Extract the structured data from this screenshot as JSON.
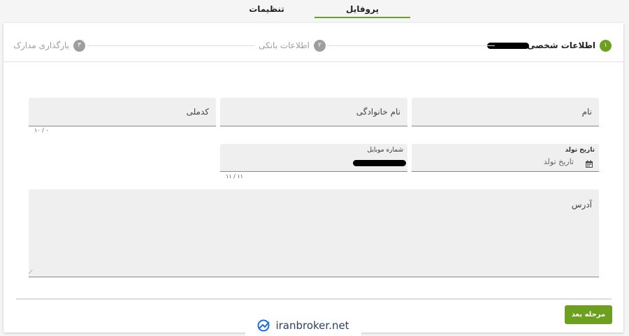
{
  "tabs": [
    {
      "label": "پروفایل",
      "active": true
    },
    {
      "label": "تنظیمات",
      "active": false
    }
  ],
  "stepper": {
    "steps": [
      {
        "num": "۱",
        "label": "اطلاعات شخصی"
      },
      {
        "num": "۲",
        "label": "اطلاعات بانکی"
      },
      {
        "num": "۳",
        "label": "بارگذاری مدارک"
      }
    ]
  },
  "form": {
    "first_name_label": "نام",
    "last_name_label": "نام خانوادگی",
    "national_code_label": "کدملی",
    "national_code_counter": "۱۰ / ۰",
    "birth_date_label": "تاریخ تولد",
    "birth_date_placeholder": "تاریخ تولد",
    "mobile_label": "شماره موبایل",
    "mobile_counter": "۱۱ / ۱۱",
    "address_label": "آدرس"
  },
  "next_button": "مرحله بعد",
  "watermark": "iranbroker.net",
  "colors": {
    "accent": "#6ea020",
    "step_inactive": "#9e9e9e"
  }
}
